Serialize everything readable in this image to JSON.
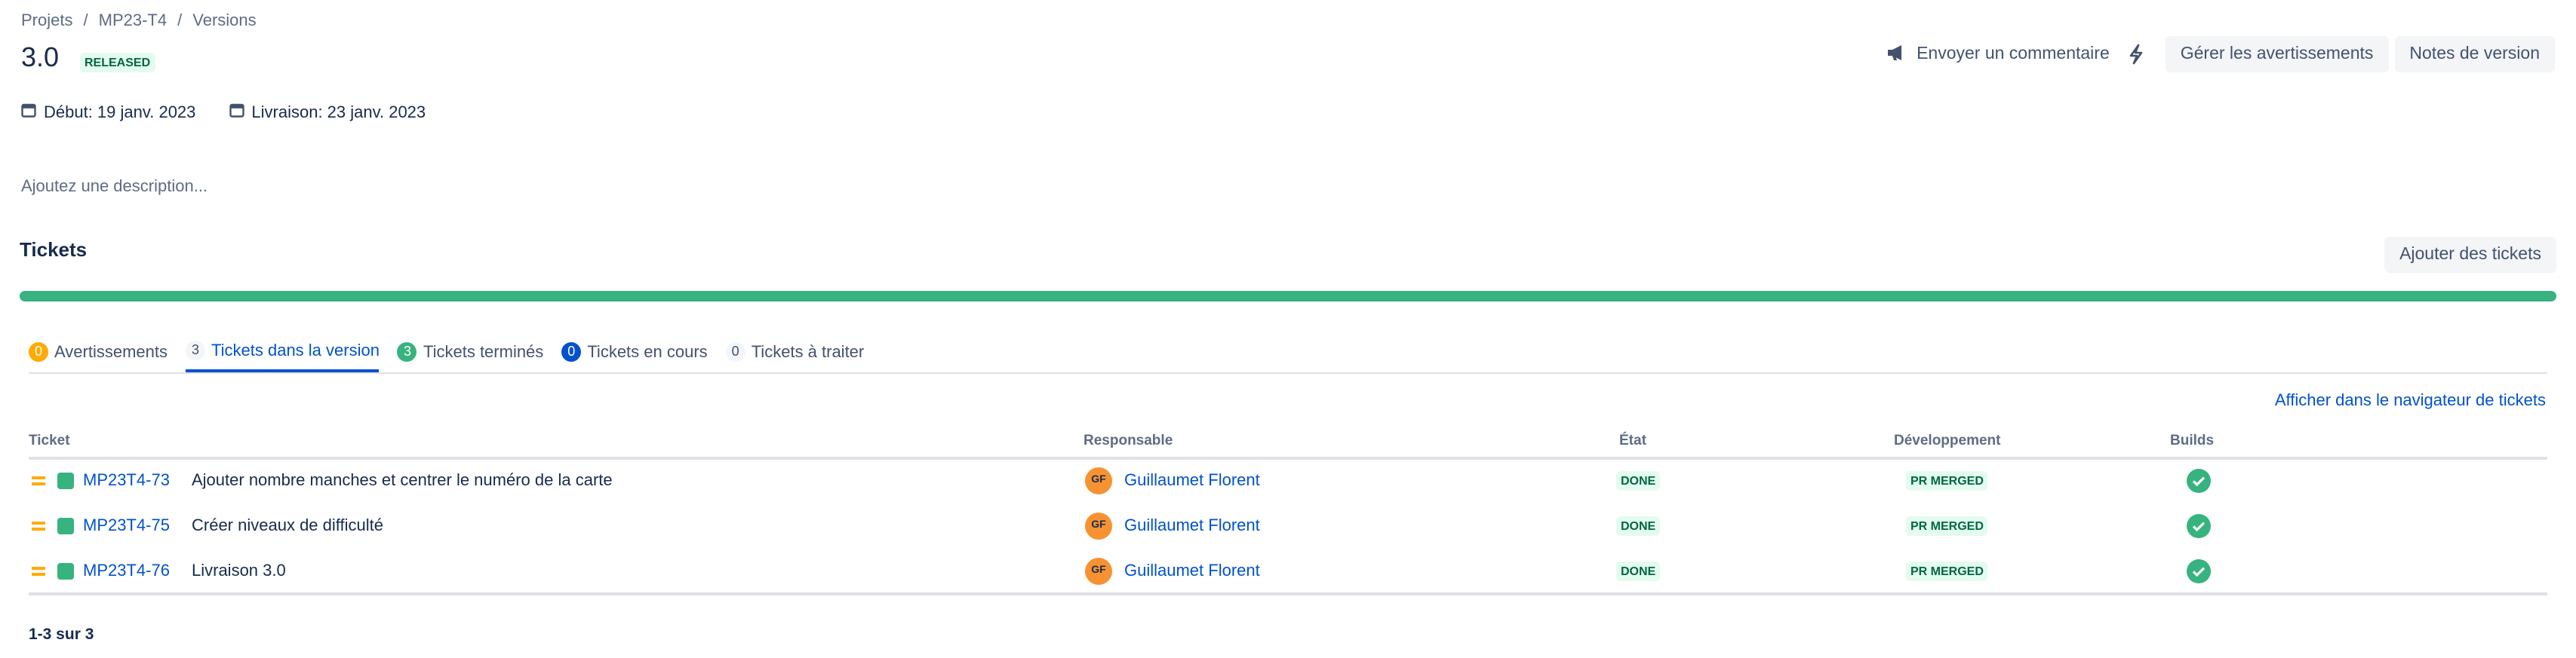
{
  "breadcrumb": [
    "Projets",
    "MP23-T4",
    "Versions"
  ],
  "version": {
    "title": "3.0",
    "status": "RELEASED"
  },
  "header_actions": {
    "feedback": "Envoyer un commentaire",
    "manage_warnings": "Gérer les avertissements",
    "release_notes": "Notes de version"
  },
  "dates": {
    "start": "Début: 19 janv. 2023",
    "release": "Livraison: 23 janv. 2023"
  },
  "description_placeholder": "Ajoutez une description...",
  "tickets_section": {
    "title": "Tickets",
    "add_button": "Ajouter des tickets",
    "progress_percent": 100
  },
  "tabs": [
    {
      "count": "0",
      "label": "Avertissements",
      "count_color": "#ffab00",
      "count_text": "#ffffff"
    },
    {
      "count": "3",
      "label": "Tickets dans la version",
      "count_color": "#f4f5f7",
      "count_text": "#42526e"
    },
    {
      "count": "3",
      "label": "Tickets terminés",
      "count_color": "#36b37e",
      "count_text": "#ffffff"
    },
    {
      "count": "0",
      "label": "Tickets en cours",
      "count_color": "#0052cc",
      "count_text": "#ffffff"
    },
    {
      "count": "0",
      "label": "Tickets à traiter",
      "count_color": "#f4f5f7",
      "count_text": "#42526e"
    }
  ],
  "view_in_navigator": "Afficher dans le navigateur de tickets",
  "table": {
    "headers": {
      "ticket": "Ticket",
      "assignee": "Responsable",
      "status": "État",
      "development": "Développement",
      "builds": "Builds"
    },
    "rows": [
      {
        "key": "MP23T4-73",
        "summary": "Ajouter nombre manches et centrer le numéro de la carte",
        "avatar": "GF",
        "assignee": "Guillaumet Florent",
        "status": "DONE",
        "development": "PR MERGED"
      },
      {
        "key": "MP23T4-75",
        "summary": "Créer niveaux de difficulté",
        "avatar": "GF",
        "assignee": "Guillaumet Florent",
        "status": "DONE",
        "development": "PR MERGED"
      },
      {
        "key": "MP23T4-76",
        "summary": "Livraison 3.0",
        "avatar": "GF",
        "assignee": "Guillaumet Florent",
        "status": "DONE",
        "development": "PR MERGED"
      }
    ]
  },
  "pagination": "1-3 sur 3",
  "colors": {
    "accent": "#0052cc",
    "success": "#36b37e",
    "priority_medium": "#ffab00",
    "avatar": "#f79232"
  }
}
